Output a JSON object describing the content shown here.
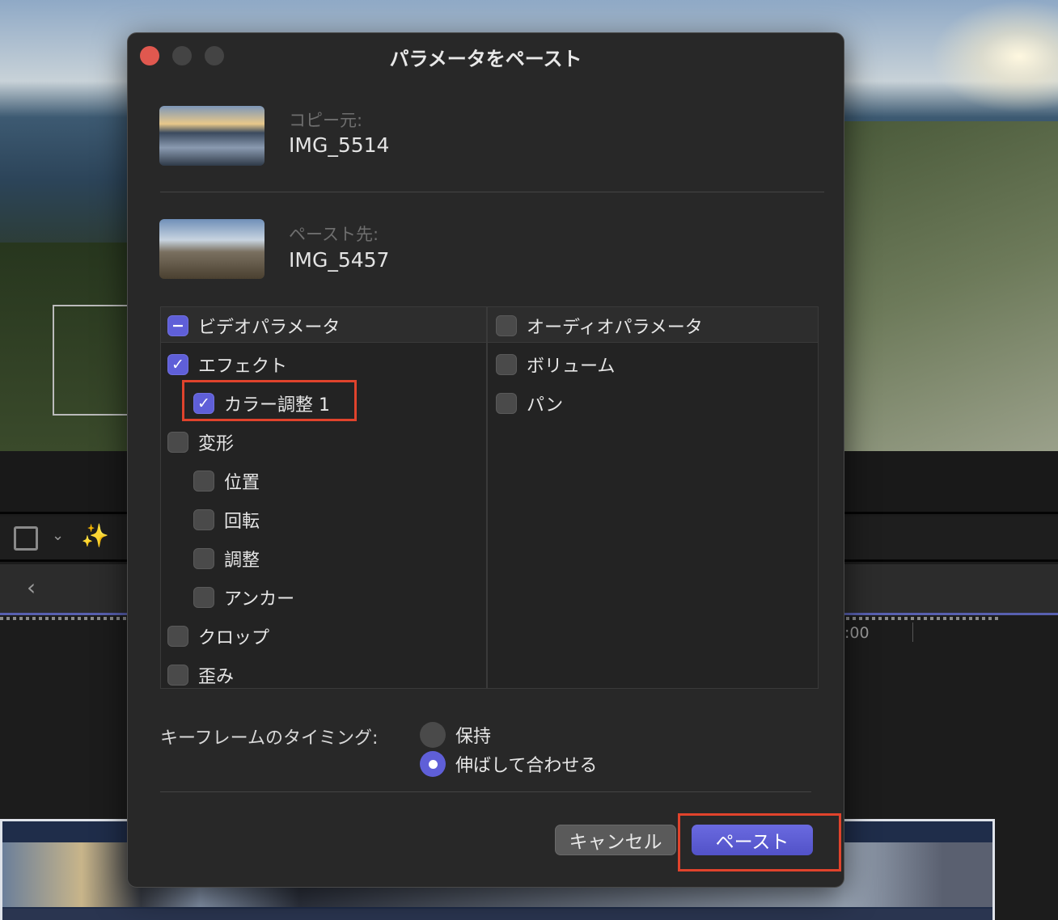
{
  "dialog": {
    "title": "パラメータをペースト",
    "source_label": "コピー元:",
    "source_clip": "IMG_5514",
    "dest_label": "ペースト先:",
    "dest_clip": "IMG_5457",
    "video": {
      "header": "ビデオパラメータ",
      "header_state": "mixed",
      "items": [
        {
          "label": "エフェクト",
          "checked": true
        },
        {
          "label": "カラー調整 1",
          "checked": true
        },
        {
          "label": "変形",
          "checked": false
        },
        {
          "label": "位置",
          "checked": false
        },
        {
          "label": "回転",
          "checked": false
        },
        {
          "label": "調整",
          "checked": false
        },
        {
          "label": "アンカー",
          "checked": false
        },
        {
          "label": "クロップ",
          "checked": false
        },
        {
          "label": "歪み",
          "checked": false
        }
      ]
    },
    "audio": {
      "header": "オーディオパラメータ",
      "items": [
        {
          "label": "ボリューム",
          "checked": false
        },
        {
          "label": "パン",
          "checked": false
        }
      ]
    },
    "keyframe_label": "キーフレームのタイミング:",
    "keyframe_options": [
      {
        "label": "保持",
        "selected": false
      },
      {
        "label": "伸ばして合わせる",
        "selected": true
      }
    ],
    "cancel_label": "キャンセル",
    "paste_label": "ペースト"
  },
  "timeline": {
    "timecode": ":00"
  },
  "colors": {
    "accent": "#5f5fd8",
    "highlight": "#e0432c",
    "close": "#e0584f"
  }
}
